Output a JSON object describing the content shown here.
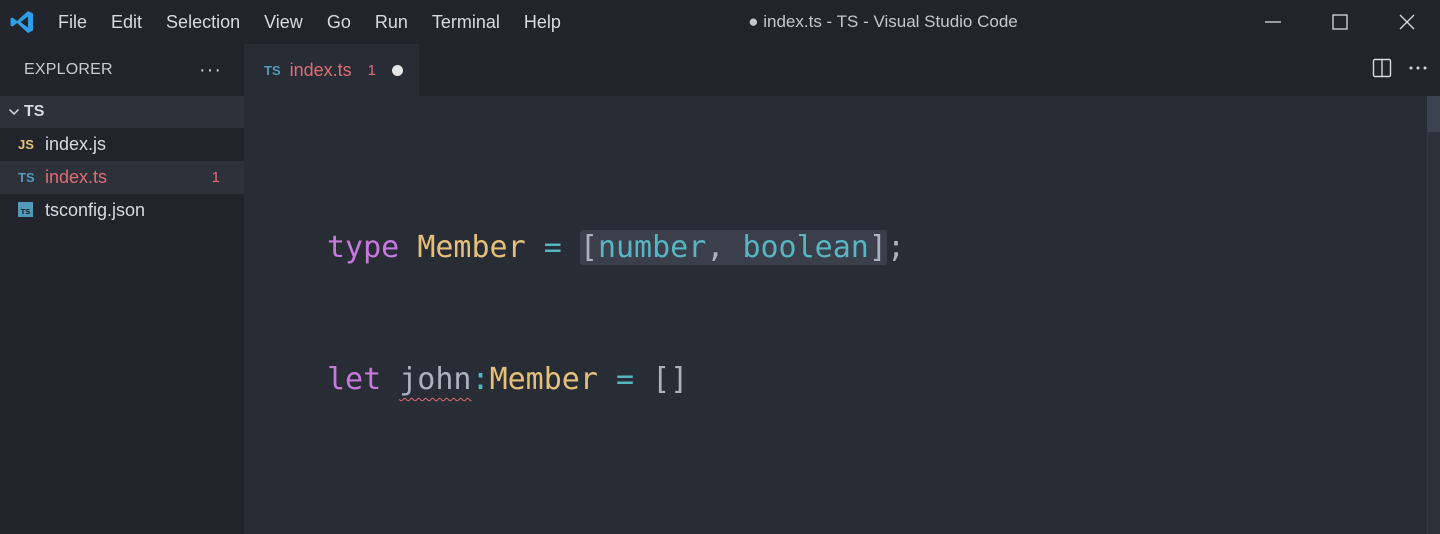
{
  "titlebar": {
    "menu": [
      "File",
      "Edit",
      "Selection",
      "View",
      "Go",
      "Run",
      "Terminal",
      "Help"
    ],
    "window_title": "● index.ts - TS - Visual Studio Code"
  },
  "sidebar": {
    "header": "EXPLORER",
    "more": "···",
    "folder": "TS",
    "files": [
      {
        "icon": "JS",
        "name": "index.js",
        "badge": ""
      },
      {
        "icon": "TS",
        "name": "index.ts",
        "badge": "1"
      },
      {
        "icon": "TS",
        "name": "tsconfig.json",
        "badge": ""
      }
    ]
  },
  "tab": {
    "icon": "TS",
    "label": "index.ts",
    "count": "1"
  },
  "editor": {
    "line1": {
      "kw": "type",
      "name": "Member",
      "eq": "=",
      "open": "[",
      "t1": "number",
      "comma": ",",
      "t2": "boolean",
      "close": "]",
      "semi": ";"
    },
    "line2": {
      "kw": "let",
      "var": "john",
      "colon": ":",
      "type": "Member",
      "eq": "=",
      "value": "[]"
    }
  },
  "colors": {
    "keyword": "#c678dd",
    "type": "#e5c07b",
    "operator": "#56b6c2",
    "error": "#e06c75",
    "ts_icon": "#519aba",
    "js_icon": "#e5c07b"
  }
}
